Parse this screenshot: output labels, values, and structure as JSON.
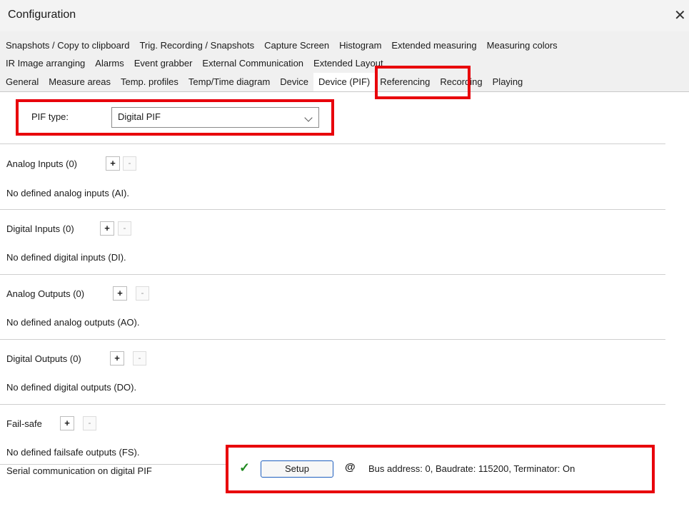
{
  "window": {
    "title": "Configuration",
    "close_label": "✕"
  },
  "tabs": {
    "row1": [
      "Snapshots / Copy to clipboard",
      "Trig. Recording / Snapshots",
      "Capture Screen",
      "Histogram",
      "Extended measuring",
      "Measuring colors"
    ],
    "row2": [
      "IR Image arranging",
      "Alarms",
      "Event grabber",
      "External Communication",
      "Extended Layout"
    ],
    "row3": [
      "General",
      "Measure areas",
      "Temp. profiles",
      "Temp/Time diagram",
      "Device",
      "Device (PIF)",
      "Referencing",
      "Recording",
      "Playing"
    ],
    "active": "Device (PIF)"
  },
  "pif": {
    "label": "PIF type:",
    "value": "Digital PIF"
  },
  "sections": {
    "analog_inputs": {
      "title": "Analog Inputs (0)",
      "add": "+",
      "remove": "-",
      "message": "No defined analog inputs (AI)."
    },
    "digital_inputs": {
      "title": "Digital Inputs (0)",
      "add": "+",
      "remove": "-",
      "message": "No defined digital inputs (DI)."
    },
    "analog_outputs": {
      "title": "Analog Outputs (0)",
      "add": "+",
      "remove": "-",
      "message": "No defined analog outputs (AO)."
    },
    "digital_outputs": {
      "title": "Digital Outputs (0)",
      "add": "+",
      "remove": "-",
      "message": "No defined digital outputs (DO)."
    },
    "fail_safe": {
      "title": "Fail-safe",
      "add": "+",
      "remove": "-",
      "message": "No defined failsafe outputs (FS)."
    }
  },
  "serial": {
    "label": "Serial communication on digital PIF",
    "status_icon": "✓",
    "setup_label": "Setup",
    "at_icon": "@",
    "info": "Bus address: 0, Baudrate: 115200, Terminator: On"
  },
  "colors": {
    "highlight": "#e8000b",
    "tab_band": "#f0f0f0",
    "check": "#1f8a1f",
    "setup_border": "#1f5fbf"
  },
  "icons": {
    "close": "close-icon",
    "dropdown": "chevron-down-icon",
    "status": "checkmark-icon",
    "address": "at-sign-icon"
  }
}
